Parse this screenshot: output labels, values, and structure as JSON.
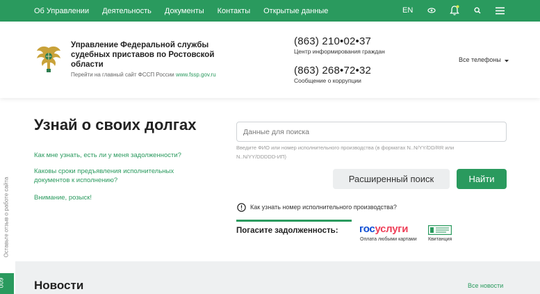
{
  "nav": {
    "items": [
      "Об Управлении",
      "Деятельность",
      "Документы",
      "Контакты",
      "Открытые данные"
    ],
    "lang": "EN",
    "icons": [
      "accessibility-eye-icon",
      "bell-icon",
      "search-icon",
      "menu-icon"
    ]
  },
  "header": {
    "org_name": "Управление Федеральной службы судебных приставов по Ростовской области",
    "org_link_prefix": "Перейти на главный сайт ФССП России",
    "org_link_url_text": "www.fssp.gov.ru",
    "phones": [
      {
        "number": "(863) 210•02•37",
        "caption": "Центр информирования граждан"
      },
      {
        "number": "(863) 268•72•32",
        "caption": "Сообщение о коррупции"
      }
    ],
    "all_phones": "Все телефоны"
  },
  "side": {
    "feedback": "Оставьте отзыв о работе сайта",
    "number": "009"
  },
  "main": {
    "title": "Узнай о своих долгах",
    "links": [
      "Как мне узнать, есть ли у меня задолженности?",
      "Каковы сроки предъявления исполнительных документов к исполнению?",
      "Внимание, розыск!"
    ]
  },
  "search": {
    "placeholder": "Данные для поиска",
    "hint": "Введите ФИО или номер исполнительного производства (в форматах N..N/YY/DD/RR или N..N/YY/DDDDD-ИП)",
    "advanced_label": "Расширенный поиск",
    "find_label": "Найти",
    "how_to": "Как узнать номер исполнительного производства?"
  },
  "pay": {
    "label": "Погасите задолженность:",
    "gosuslugi_part1": "гос",
    "gosuslugi_part2": "услуги",
    "gosuslugi_caption": "Оплата любыми картами",
    "receipt_caption": "Квитанция"
  },
  "news": {
    "title": "Новости",
    "all_label": "Все новости"
  },
  "colors": {
    "brand_green": "#2a9a5e",
    "gos_blue": "#0d4cd3",
    "gos_red": "#ee3f58"
  }
}
